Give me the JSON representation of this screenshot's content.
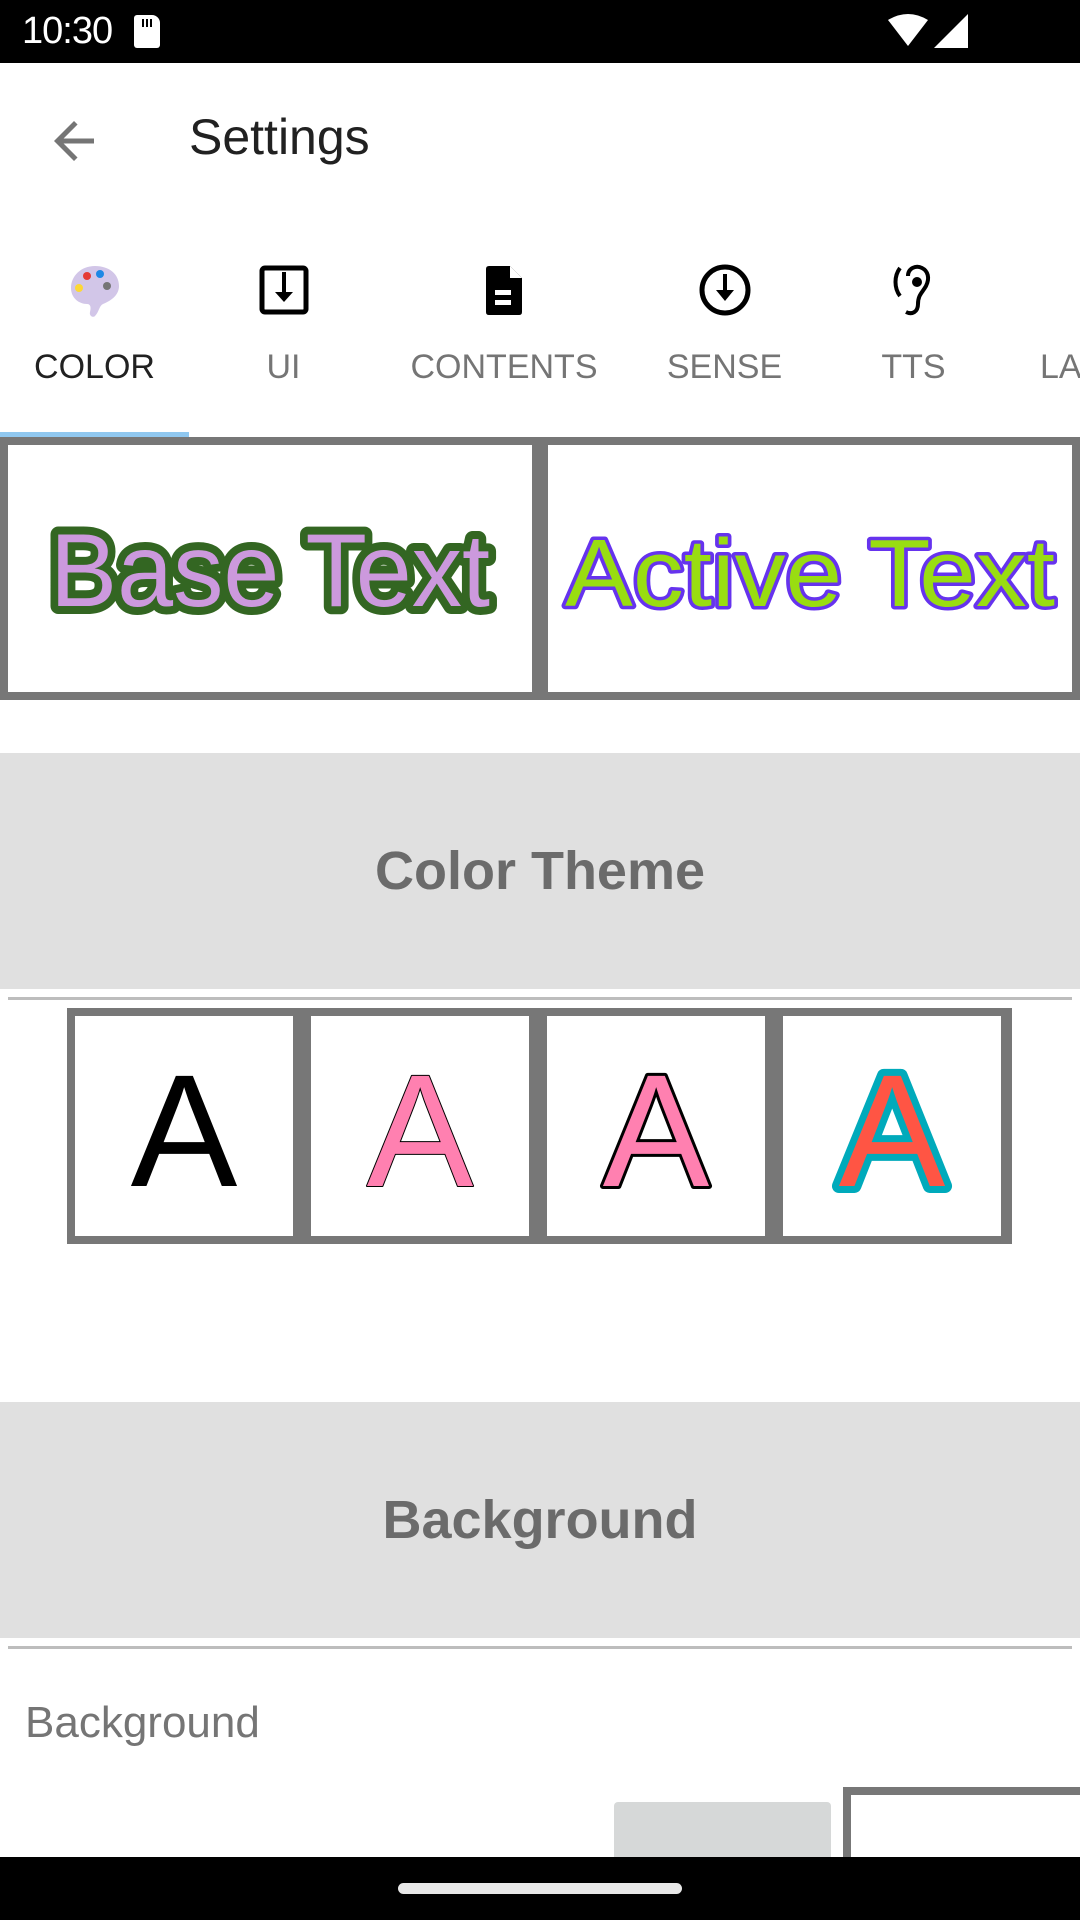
{
  "status_bar": {
    "time": "10:30",
    "icons": [
      "sd-card-icon",
      "wifi-icon",
      "signal-icon"
    ]
  },
  "app_bar": {
    "back_icon": "arrow-back-icon",
    "title": "Settings"
  },
  "tabs": [
    {
      "label": "COLOR",
      "icon": "palette-icon",
      "active": true
    },
    {
      "label": "UI",
      "icon": "download-box-icon",
      "active": false
    },
    {
      "label": "CONTENTS",
      "icon": "document-icon",
      "active": false
    },
    {
      "label": "SENSE",
      "icon": "download-circle-icon",
      "active": false
    },
    {
      "label": "TTS",
      "icon": "hearing-icon",
      "active": false
    },
    {
      "label": "LA",
      "icon": "",
      "active": false
    }
  ],
  "preview": {
    "base_text": "Base Text",
    "base_fill": "#cc99dd",
    "base_stroke": "#336622",
    "active_text": "Active Text",
    "active_fill": "#99dd11",
    "active_stroke": "#6633ee"
  },
  "sections": {
    "color_theme": "Color Theme",
    "background": "Background"
  },
  "themes": [
    {
      "glyph": "A",
      "fill": "#000000",
      "stroke": "none"
    },
    {
      "glyph": "A",
      "fill": "#ff80b0",
      "stroke": "#000000"
    },
    {
      "glyph": "A",
      "fill": "#ff80b0",
      "stroke": "#000000"
    },
    {
      "glyph": "A",
      "fill": "#ff5544",
      "stroke": "#00aabb"
    }
  ],
  "background": {
    "label": "Background",
    "swatches": [
      "#d6d8d8",
      "#ffffff"
    ]
  }
}
